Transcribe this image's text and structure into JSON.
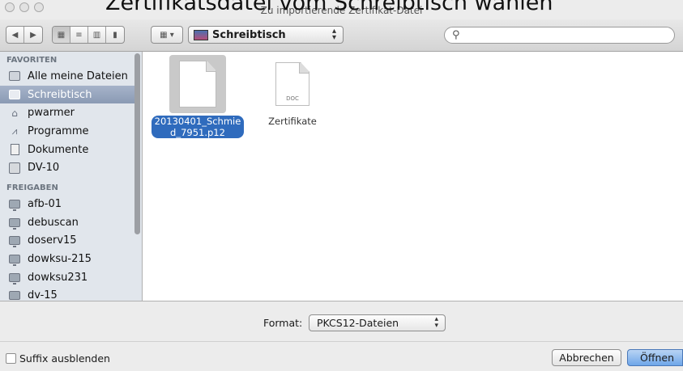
{
  "overlay_caption": "Zertifikatsdatei vom Schreibtisch wählen",
  "window": {
    "title": "Zu importierende Zertifikat-Datei"
  },
  "toolbar": {
    "location": "Schreibtisch",
    "search_placeholder": ""
  },
  "sidebar": {
    "favorites_header": "FAVORITEN",
    "favorites": [
      {
        "label": "Alle meine Dateien",
        "icon": "all-files-icon"
      },
      {
        "label": "Schreibtisch",
        "icon": "desktop-icon",
        "selected": true
      },
      {
        "label": "pwarmer",
        "icon": "home-icon"
      },
      {
        "label": "Programme",
        "icon": "applications-icon"
      },
      {
        "label": "Dokumente",
        "icon": "documents-icon"
      },
      {
        "label": "DV-10",
        "icon": "disk-icon"
      }
    ],
    "shared_header": "FREIGABEN",
    "shared": [
      {
        "label": "afb-01",
        "icon": "computer-icon"
      },
      {
        "label": "debuscan",
        "icon": "computer-icon"
      },
      {
        "label": "doserv15",
        "icon": "computer-icon"
      },
      {
        "label": "dowksu-215",
        "icon": "computer-icon"
      },
      {
        "label": "dowksu231",
        "icon": "computer-icon"
      },
      {
        "label": "dv-15",
        "icon": "computer-icon"
      }
    ]
  },
  "files": [
    {
      "name_line1": "20130401_Schmie",
      "name_line2": "d_7951.p12",
      "selected": true
    },
    {
      "name_line1": "Zertifikate",
      "kind": "DOC"
    }
  ],
  "format": {
    "label": "Format:",
    "value": "PKCS12-Dateien"
  },
  "bottom": {
    "hide_suffix": "Suffix ausblenden",
    "cancel": "Abbrechen",
    "open": "Öffnen"
  }
}
